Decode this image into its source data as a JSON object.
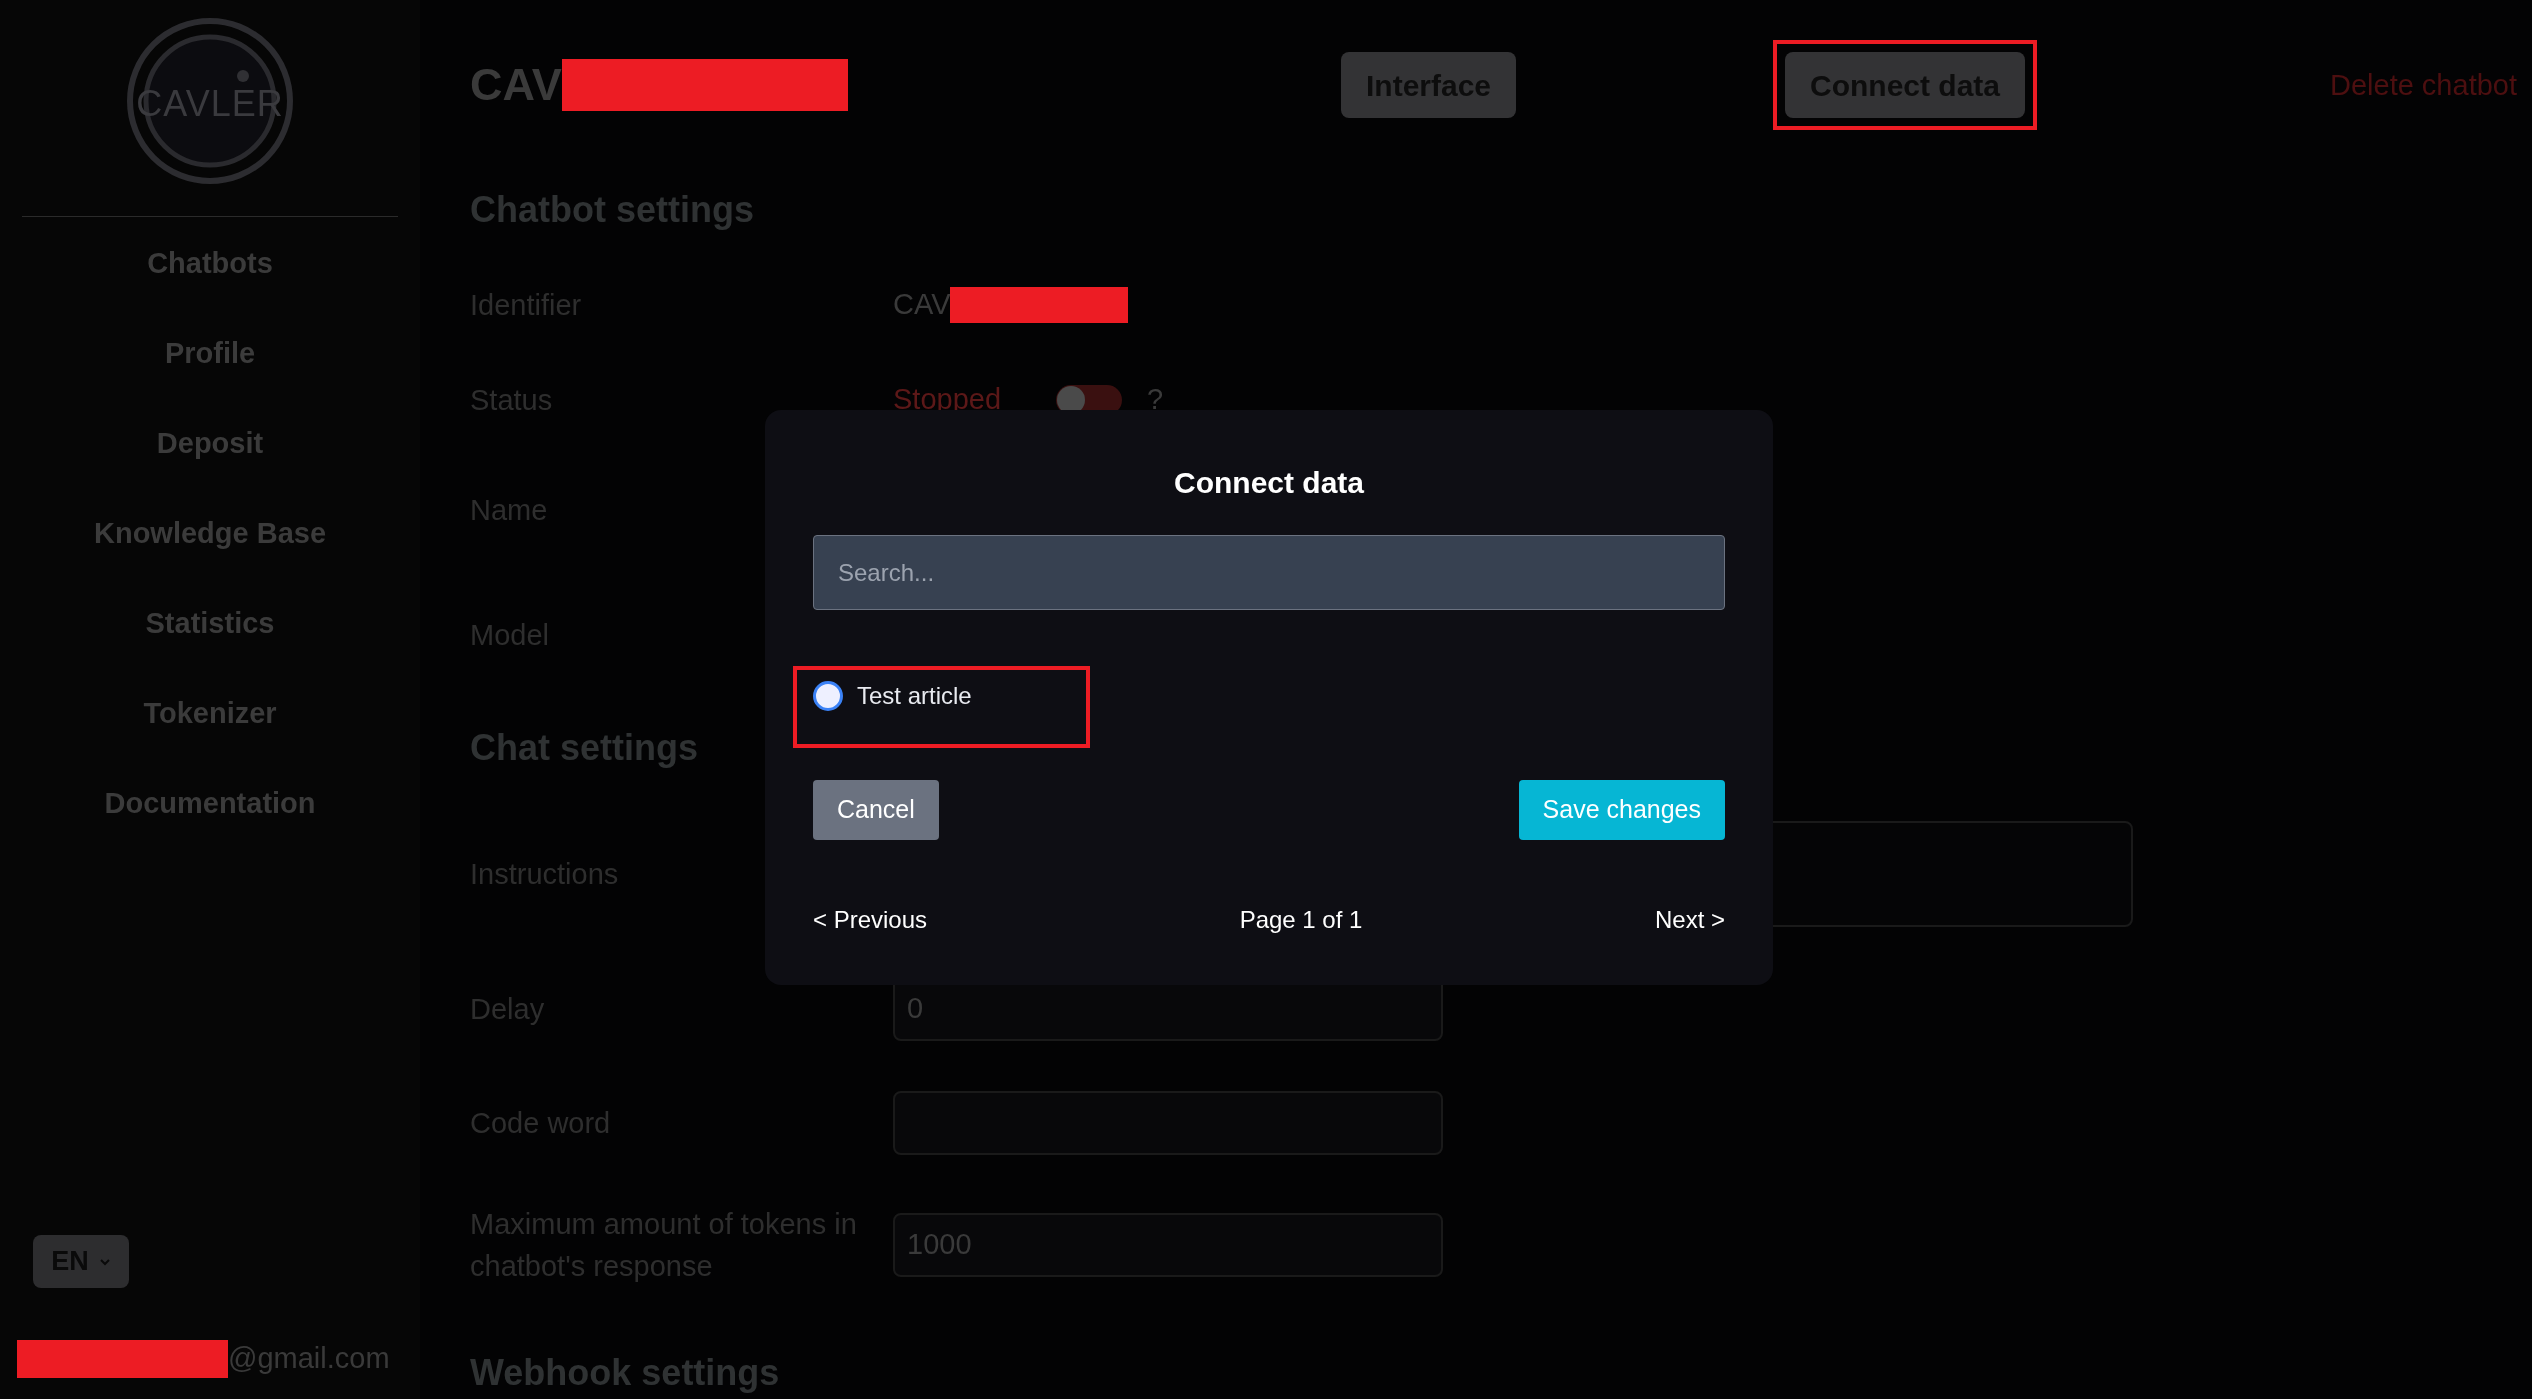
{
  "sidebar": {
    "logo": "CAVLER",
    "items": [
      {
        "label": "Chatbots"
      },
      {
        "label": "Profile"
      },
      {
        "label": "Deposit"
      },
      {
        "label": "Knowledge Base"
      },
      {
        "label": "Statistics"
      },
      {
        "label": "Tokenizer"
      },
      {
        "label": "Documentation"
      }
    ],
    "language": "EN",
    "email": {
      "text": "@gmail.com",
      "redacted": true
    }
  },
  "header": {
    "title": "CAV",
    "redacted": true,
    "buttons": [
      {
        "label": "Interface",
        "highlighted": false
      },
      {
        "label": "Connect data",
        "highlighted": true
      }
    ],
    "delete": "Delete chatbot"
  },
  "rows": [
    {
      "kind": "heading",
      "label": "Chatbot settings"
    },
    {
      "kind": "text",
      "label": "Identifier",
      "value": "CAV",
      "redacted": true
    },
    {
      "kind": "toggle",
      "label": "Status",
      "value": "Stopped",
      "on": false,
      "help": "?"
    },
    {
      "kind": "hidden",
      "label": "Name"
    },
    {
      "kind": "hidden",
      "label": "Model"
    },
    {
      "kind": "heading",
      "label": "Chat settings"
    },
    {
      "kind": "textarea",
      "label": "Instructions"
    },
    {
      "kind": "input",
      "label": "Delay",
      "value": "0"
    },
    {
      "kind": "input",
      "label": "Code word"
    },
    {
      "kind": "input",
      "label": "Maximum amount of tokens in chatbot's response",
      "value": "1000"
    },
    {
      "kind": "heading",
      "label": "Webhook settings"
    }
  ],
  "modal": {
    "title": "Connect data",
    "search": {
      "placeholder": "Search..."
    },
    "options": [
      {
        "label": "Test article",
        "selected": false,
        "highlighted": true
      }
    ],
    "buttons": [
      {
        "kind": "cancel",
        "label": "Cancel"
      },
      {
        "kind": "save",
        "label": "Save changes"
      }
    ],
    "pagination": {
      "previous": "< Previous",
      "page": "Page 1 of 1",
      "next": "Next >"
    }
  }
}
